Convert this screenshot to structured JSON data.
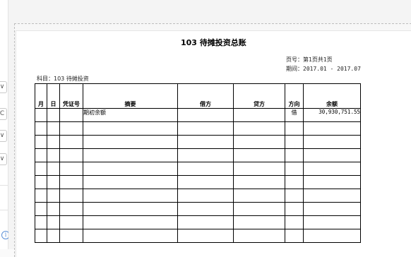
{
  "left_panel": {
    "controls": [
      "∨",
      "C",
      "∨",
      "∨"
    ],
    "info_icon": "i"
  },
  "report": {
    "title": "103 待摊投资总账",
    "page_label": "页号：第1页共1页",
    "period_label": "期间：",
    "period_value": "2017.01 - 2017.07",
    "subject_label": "科目：",
    "subject_value": "103  待摊投资"
  },
  "table": {
    "headers": {
      "month": "月",
      "day": "日",
      "voucher": "凭证号",
      "summary": "摘要",
      "debit": "借方",
      "credit": "贷方",
      "direction": "方向",
      "balance": "余额"
    },
    "rows": [
      {
        "month": "",
        "day": "",
        "voucher": "",
        "summary": "期初余额",
        "debit": "",
        "credit": "",
        "direction": "借",
        "balance": "30,930,751.55"
      },
      {
        "month": "",
        "day": "",
        "voucher": "",
        "summary": "",
        "debit": "",
        "credit": "",
        "direction": "",
        "balance": ""
      },
      {
        "month": "",
        "day": "",
        "voucher": "",
        "summary": "",
        "debit": "",
        "credit": "",
        "direction": "",
        "balance": ""
      },
      {
        "month": "",
        "day": "",
        "voucher": "",
        "summary": "",
        "debit": "",
        "credit": "",
        "direction": "",
        "balance": ""
      },
      {
        "month": "",
        "day": "",
        "voucher": "",
        "summary": "",
        "debit": "",
        "credit": "",
        "direction": "",
        "balance": ""
      },
      {
        "month": "",
        "day": "",
        "voucher": "",
        "summary": "",
        "debit": "",
        "credit": "",
        "direction": "",
        "balance": ""
      },
      {
        "month": "",
        "day": "",
        "voucher": "",
        "summary": "",
        "debit": "",
        "credit": "",
        "direction": "",
        "balance": ""
      },
      {
        "month": "",
        "day": "",
        "voucher": "",
        "summary": "",
        "debit": "",
        "credit": "",
        "direction": "",
        "balance": ""
      },
      {
        "month": "",
        "day": "",
        "voucher": "",
        "summary": "",
        "debit": "",
        "credit": "",
        "direction": "",
        "balance": ""
      },
      {
        "month": "",
        "day": "",
        "voucher": "",
        "summary": "",
        "debit": "",
        "credit": "",
        "direction": "",
        "balance": ""
      }
    ]
  }
}
